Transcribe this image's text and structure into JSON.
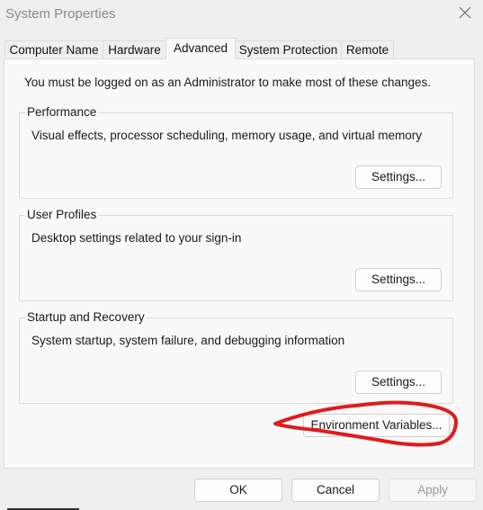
{
  "window": {
    "title": "System Properties",
    "close_icon": "close-icon"
  },
  "tabs": [
    {
      "label": "Computer Name",
      "active": false
    },
    {
      "label": "Hardware",
      "active": false
    },
    {
      "label": "Advanced",
      "active": true
    },
    {
      "label": "System Protection",
      "active": false
    },
    {
      "label": "Remote",
      "active": false
    }
  ],
  "advanced": {
    "notice": "You must be logged on as an Administrator to make most of these changes.",
    "groups": [
      {
        "title": "Performance",
        "description": "Visual effects, processor scheduling, memory usage, and virtual memory",
        "button": "Settings..."
      },
      {
        "title": "User Profiles",
        "description": "Desktop settings related to your sign-in",
        "button": "Settings..."
      },
      {
        "title": "Startup and Recovery",
        "description": "System startup, system failure, and debugging information",
        "button": "Settings..."
      }
    ],
    "environment_button": "Environment Variables..."
  },
  "footer": {
    "ok": "OK",
    "cancel": "Cancel",
    "apply": "Apply"
  },
  "annotation": {
    "type": "hand-drawn circle",
    "color": "#e01b1b",
    "target": "Environment Variables..."
  }
}
